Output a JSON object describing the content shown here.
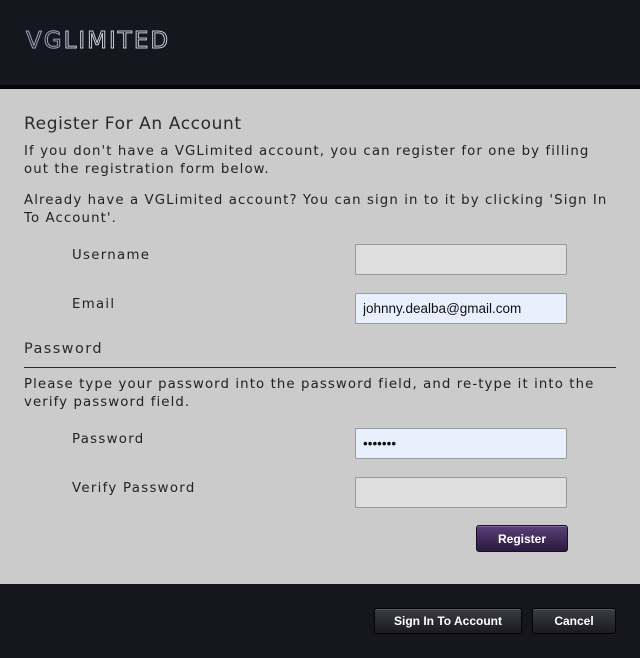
{
  "header": {
    "logo_part1": "VG",
    "logo_part2": "LIMITED"
  },
  "register": {
    "title": "Register For An Account",
    "intro": "If you don't have a VGLimited account, you can register for one by filling out the registration form below.",
    "signin_hint": "Already have a VGLimited account? You can sign in to it by clicking 'Sign In To Account'.",
    "username_label": "Username",
    "username_value": "",
    "email_label": "Email",
    "email_value": "johnny.dealba@gmail.com"
  },
  "password_section": {
    "heading": "Password",
    "instructions": "Please type your password into the password field, and re-type it into the verify password field.",
    "password_label": "Password",
    "password_value": "•••••••",
    "verify_label": "Verify Password",
    "verify_value": ""
  },
  "buttons": {
    "register": "Register",
    "sign_in": "Sign In To Account",
    "cancel": "Cancel"
  },
  "colors": {
    "header_bg": "#16161f",
    "panel_bg": "#cbcbcb",
    "register_button": "#4a3266",
    "autofill_bg": "#e8f0fe"
  }
}
